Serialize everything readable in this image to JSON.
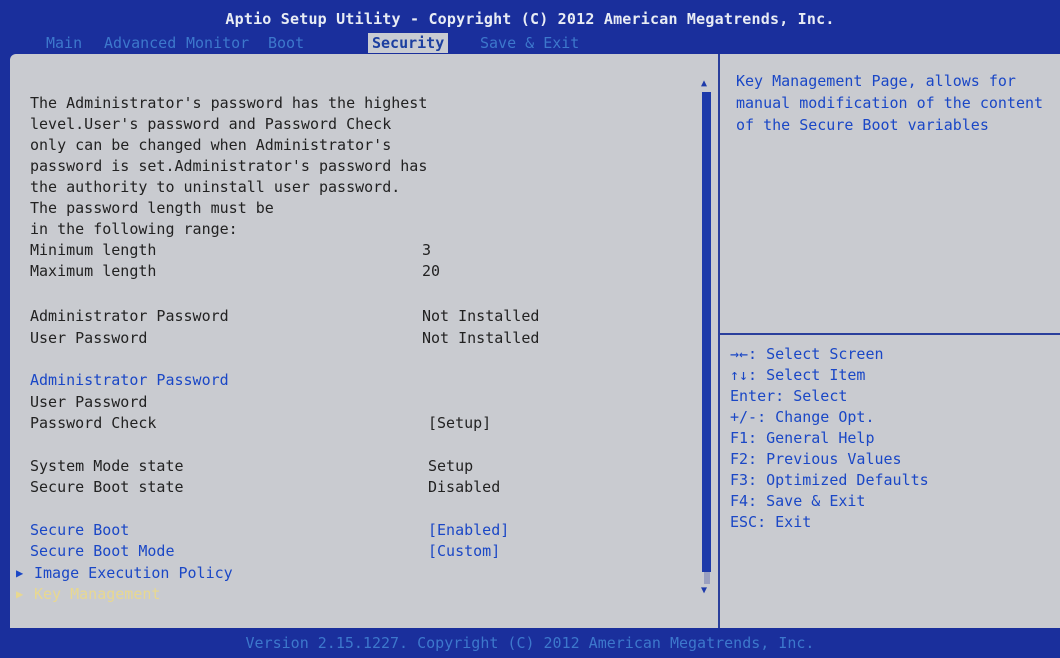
{
  "header": {
    "title": "Aptio Setup Utility - Copyright (C) 2012 American Megatrends, Inc.",
    "tabs": [
      "Main",
      "Advanced",
      "Monitor",
      "Boot",
      "Security",
      "Save & Exit"
    ],
    "active_tab": "Security"
  },
  "main": {
    "description": [
      "The Administrator's password has the highest",
      "level.User's password and Password Check",
      "only can be changed when Administrator's",
      "password is set.Administrator's password has",
      "the authority to uninstall user password.",
      "The password length must be",
      "in the following range:"
    ],
    "min_length": {
      "label": "Minimum length",
      "value": "3"
    },
    "max_length": {
      "label": "Maximum length",
      "value": "20"
    },
    "admin_status": {
      "label": "Administrator Password",
      "value": "Not Installed"
    },
    "user_status": {
      "label": "User Password",
      "value": "Not Installed"
    },
    "admin_password_item": "Administrator Password",
    "user_password_item": "User Password",
    "password_check": {
      "label": "Password Check",
      "value": "[Setup]"
    },
    "system_mode": {
      "label": "System Mode state",
      "value": "Setup"
    },
    "secure_boot_state": {
      "label": "Secure Boot state",
      "value": "Disabled"
    },
    "secure_boot": {
      "label": "Secure Boot",
      "value": "[Enabled]"
    },
    "secure_boot_mode": {
      "label": "Secure Boot Mode",
      "value": "[Custom]"
    },
    "image_execution_policy": "Image Execution Policy",
    "key_management": "Key Management"
  },
  "help": {
    "text": "Key Management Page, allows for manual modification of the content of the Secure Boot variables",
    "keys": [
      "→←: Select Screen",
      "↑↓: Select Item",
      "Enter: Select",
      "+/-: Change Opt.",
      "F1: General Help",
      "F2: Previous Values",
      "F3: Optimized Defaults",
      "F4: Save & Exit",
      "ESC: Exit"
    ]
  },
  "footer": "Version 2.15.1227. Copyright (C) 2012 American Megatrends, Inc.",
  "colors": {
    "background": "#1a2f9c",
    "panel": "#c9cbd0",
    "highlight_blue": "#1a47c6",
    "selected_item": "#e8d890"
  }
}
